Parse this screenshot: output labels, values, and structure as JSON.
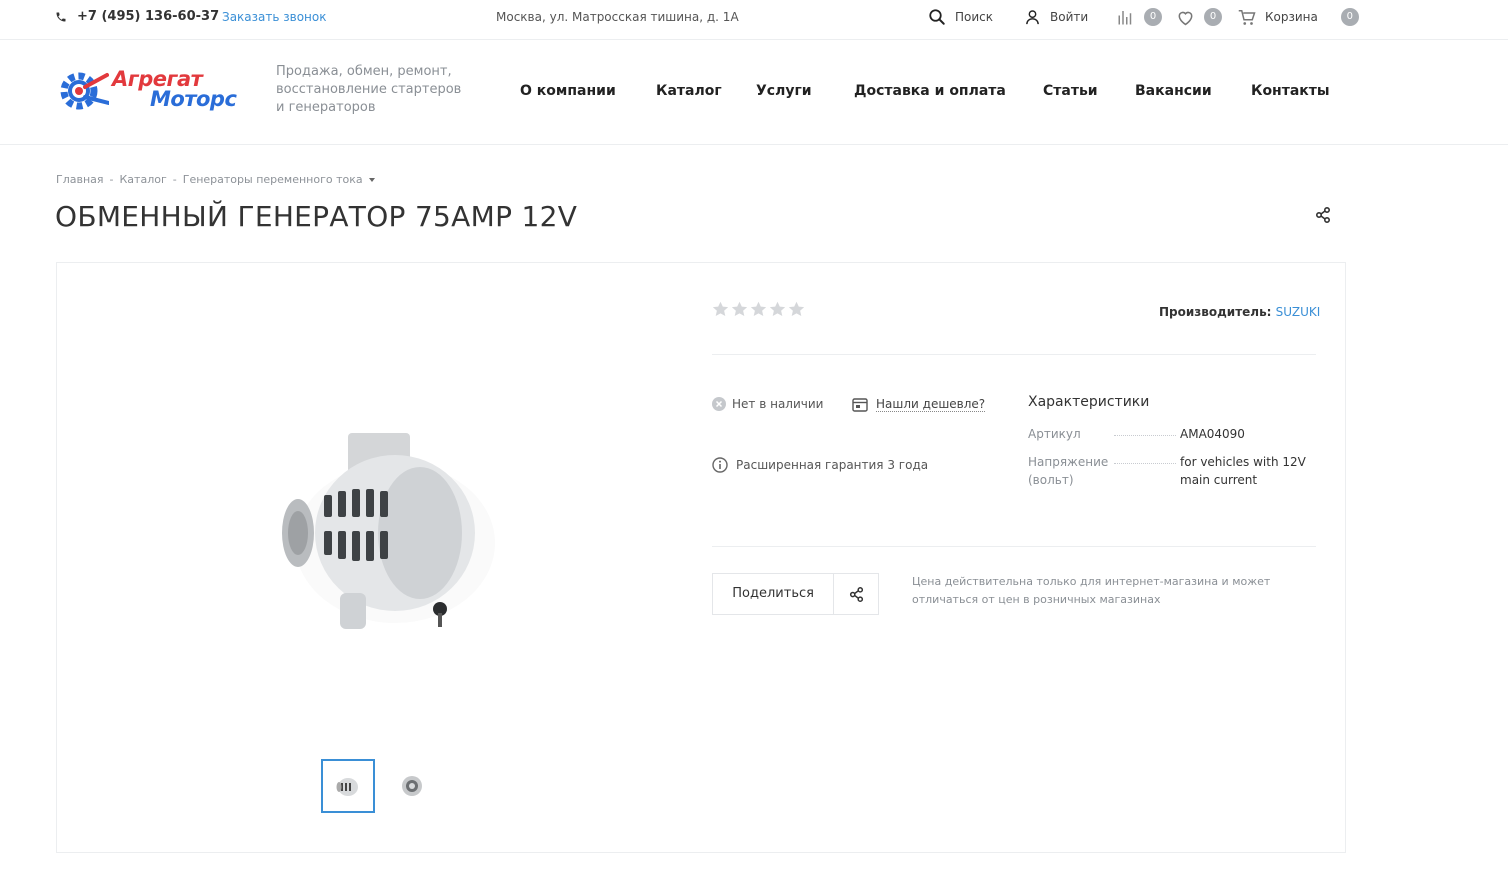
{
  "topbar": {
    "phone": "+7 (495) 136-60-37",
    "callback": "Заказать звонок",
    "address": "Москва, ул. Матросская тишина, д. 1А",
    "search": "Поиск",
    "login": "Войти",
    "compare_count": "0",
    "favorites_count": "0",
    "cart": "Корзина",
    "cart_count": "0"
  },
  "header": {
    "logo_line1": "Агрегат",
    "logo_line2": "Моторс",
    "tagline": "Продажа, обмен, ремонт, восстановление стартеров и генераторов",
    "nav": [
      "О компании",
      "Каталог",
      "Услуги",
      "Доставка и оплата",
      "Статьи",
      "Вакансии",
      "Контакты"
    ]
  },
  "breadcrumb": {
    "items": [
      "Главная",
      "Каталог",
      "Генераторы переменного тока"
    ],
    "separator": "-"
  },
  "page_title": "ОБМЕННЫЙ ГЕНЕРАТОР 75AMP 12V",
  "product": {
    "rating": 0,
    "rating_max": 5,
    "manufacturer_label": "Производитель:",
    "manufacturer": "SUZUKI",
    "availability": "Нет в наличии",
    "found_cheaper": "Нашли дешевле?",
    "warranty": "Расширенная гарантия 3 года",
    "specs_title": "Характеристики",
    "specs": [
      {
        "name": "Артикул",
        "value": "AMA04090"
      },
      {
        "name": "Напряжение (вольт)",
        "value": "for vehicles with 12V main current"
      }
    ],
    "share_label": "Поделиться",
    "price_note": "Цена действительна только для интернет-магазина и может отличаться от цен в розничных магазинах"
  },
  "colors": {
    "accent": "#3a8fd6",
    "logo_red": "#e2393d",
    "logo_blue": "#2a6dd8",
    "muted": "#8a8f95"
  }
}
